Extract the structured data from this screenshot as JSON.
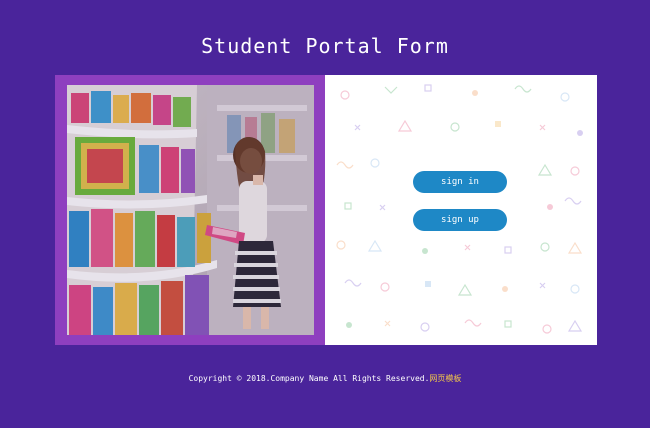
{
  "page": {
    "title": "Student Portal Form"
  },
  "form": {
    "signin_label": "sign in",
    "signup_label": "sign up"
  },
  "footer": {
    "copyright": "Copyright © 2018.Company Name All Rights Reserved.",
    "link": "网页模板"
  },
  "colors": {
    "background": "#4a249b",
    "photo_frame": "#8e3fbf",
    "button": "#1e88c6",
    "footer_link": "#f4c74a"
  }
}
